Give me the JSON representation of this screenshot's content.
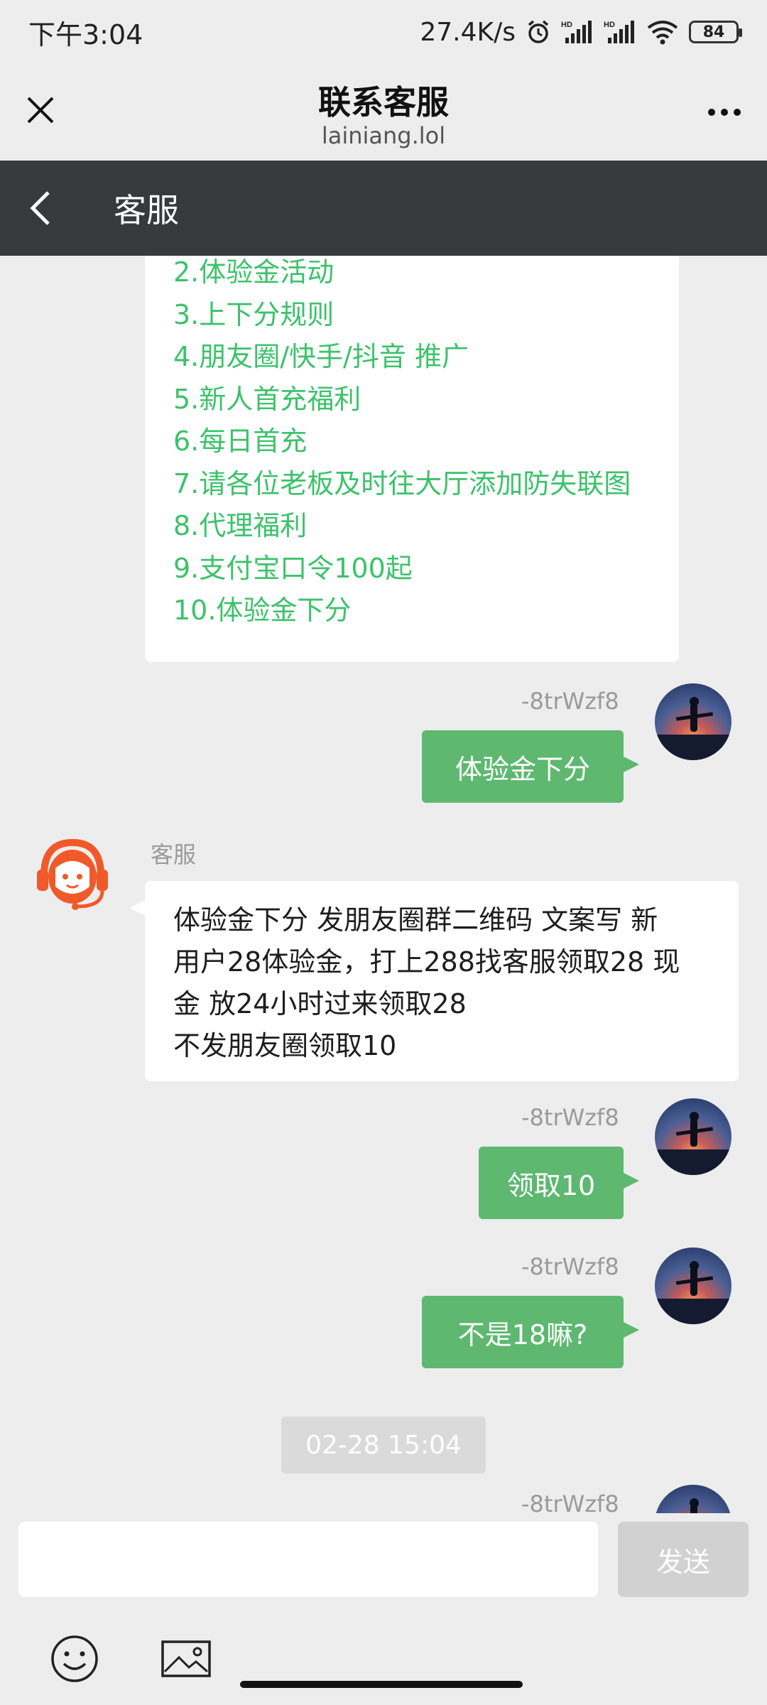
{
  "status_bar": {
    "time": "下午3:04",
    "net_speed": "27.4K/s",
    "battery": "84",
    "icons": [
      "alarm-icon",
      "hd-signal-icon",
      "hd-signal-icon",
      "wifi-icon",
      "battery-icon"
    ]
  },
  "web_header": {
    "title": "联系客服",
    "url": "lainiang.lol",
    "more": "•••"
  },
  "app_bar": {
    "title": "客服"
  },
  "menu": {
    "items": [
      "2.体验金活动",
      "3.上下分规则",
      "4.朋友圈/快手/抖音 推广",
      "5.新人首充福利",
      "6.每日首充",
      "7.请各位老板及时往大厅添加防失联图",
      "8.代理福利",
      "9.支付宝口令100起",
      "10.体验金下分"
    ]
  },
  "messages": {
    "me_name": "-8trWzf8",
    "cs_name": "客服",
    "m1": "体验金下分",
    "cs1_line1": "体验金下分 发朋友圈群二维码 文案写 新",
    "cs1_line2": "用户28体验金，打上288找客服领取28 现",
    "cs1_line3": "金 放24小时过来领取28",
    "cs1_line4": "不发朋友圈领取10",
    "m2": "领取10",
    "m3": "不是18嘛?",
    "timestamp": "02-28 15:04"
  },
  "input": {
    "placeholder": "",
    "send_label": "发送"
  },
  "colors": {
    "accent_green": "#5eb870",
    "menu_green": "#3cc26b",
    "app_bar": "#38393c",
    "cs_avatar": "#f05a2a"
  }
}
